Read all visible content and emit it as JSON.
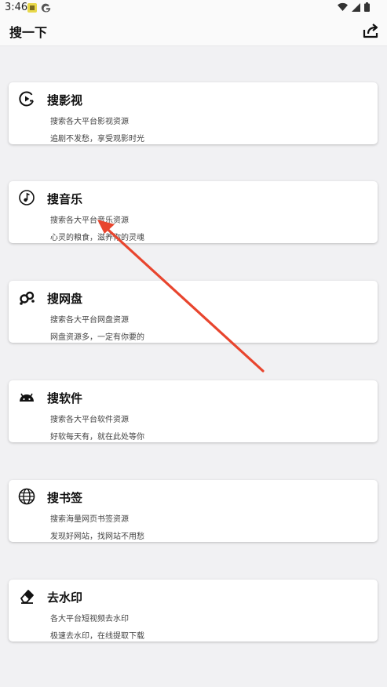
{
  "status": {
    "time": "3:46"
  },
  "header": {
    "title": "搜一下",
    "share_icon": "share-icon"
  },
  "cards": [
    {
      "icon": "play-circle-icon",
      "title": "搜影视",
      "desc": "搜索各大平台影视资源",
      "sub": "追剧不发愁，享受观影时光"
    },
    {
      "icon": "music-note-icon",
      "title": "搜音乐",
      "desc": "搜索各大平台音乐资源",
      "sub": "心灵的粮食，滋养你的灵魂"
    },
    {
      "icon": "cloud-disk-icon",
      "title": "搜网盘",
      "desc": "搜索各大平台网盘资源",
      "sub": "网盘资源多，一定有你要的"
    },
    {
      "icon": "android-icon",
      "title": "搜软件",
      "desc": "搜索各大平台软件资源",
      "sub": "好软每天有，就在此处等你"
    },
    {
      "icon": "globe-icon",
      "title": "搜书签",
      "desc": "搜索海量网页书签资源",
      "sub": "发现好网站，找网站不用愁"
    },
    {
      "icon": "eraser-icon",
      "title": "去水印",
      "desc": "各大平台短视频去水印",
      "sub": "极速去水印，在线提取下载"
    }
  ],
  "colors": {
    "annotation_arrow": "#e8452e",
    "background": "#f1f1f3"
  }
}
